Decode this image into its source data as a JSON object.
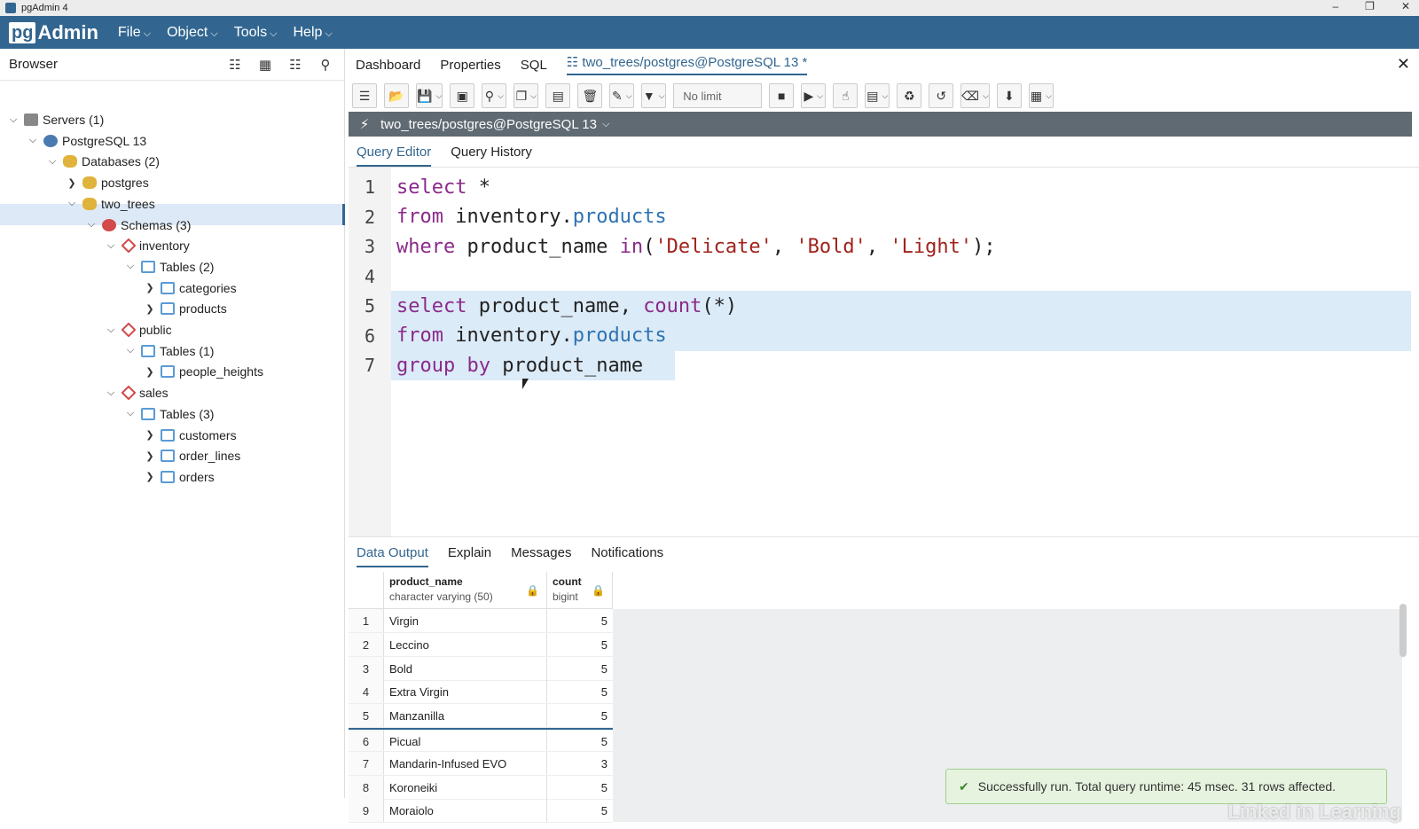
{
  "window": {
    "title": "pgAdmin 4",
    "controls": [
      "–",
      "❐",
      "✕"
    ]
  },
  "menubar": {
    "logo_pg": "pg",
    "logo_admin": "Admin",
    "items": [
      "File",
      "Object",
      "Tools",
      "Help"
    ]
  },
  "browser": {
    "title": "Browser",
    "tree": [
      {
        "label": "Servers (1)",
        "icon": "server-icon",
        "expanded": true
      },
      {
        "label": "PostgreSQL 13",
        "icon": "postgres-icon",
        "expanded": true
      },
      {
        "label": "Databases (2)",
        "icon": "databases-icon",
        "expanded": true
      },
      {
        "label": "postgres",
        "icon": "database-icon",
        "expanded": false
      },
      {
        "label": "two_trees",
        "icon": "database-icon",
        "expanded": true
      },
      {
        "label": "Schemas (3)",
        "icon": "schemas-icon",
        "expanded": true
      },
      {
        "label": "inventory",
        "icon": "schema-icon",
        "expanded": true,
        "selected": true
      },
      {
        "label": "Tables (2)",
        "icon": "tables-icon",
        "expanded": true
      },
      {
        "label": "categories",
        "icon": "table-icon",
        "expanded": false
      },
      {
        "label": "products",
        "icon": "table-icon",
        "expanded": false
      },
      {
        "label": "public",
        "icon": "schema-icon",
        "expanded": true
      },
      {
        "label": "Tables (1)",
        "icon": "tables-icon",
        "expanded": true
      },
      {
        "label": "people_heights",
        "icon": "table-icon",
        "expanded": false
      },
      {
        "label": "sales",
        "icon": "schema-icon",
        "expanded": true
      },
      {
        "label": "Tables (3)",
        "icon": "tables-icon",
        "expanded": true
      },
      {
        "label": "customers",
        "icon": "table-icon",
        "expanded": false
      },
      {
        "label": "order_lines",
        "icon": "table-icon",
        "expanded": false
      },
      {
        "label": "orders",
        "icon": "table-icon",
        "expanded": false
      }
    ]
  },
  "main_tabs": [
    "Dashboard",
    "Properties",
    "SQL",
    "two_trees/postgres@PostgreSQL 13 *"
  ],
  "toolbar": {
    "limit": "No limit"
  },
  "connection": "two_trees/postgres@PostgreSQL 13",
  "query_tabs": [
    "Query Editor",
    "Query History"
  ],
  "editor_lines": [
    "select *",
    "from inventory.products",
    "where product_name in('Delicate', 'Bold', 'Light');",
    "",
    "select product_name, count(*)",
    "from inventory.products",
    "group by product_name"
  ],
  "output_tabs": [
    "Data Output",
    "Explain",
    "Messages",
    "Notifications"
  ],
  "result": {
    "columns": [
      {
        "name": "product_name",
        "type": "character varying (50)"
      },
      {
        "name": "count",
        "type": "bigint"
      }
    ],
    "rows": [
      [
        "Virgin",
        "5"
      ],
      [
        "Leccino",
        "5"
      ],
      [
        "Bold",
        "5"
      ],
      [
        "Extra Virgin",
        "5"
      ],
      [
        "Manzanilla",
        "5"
      ],
      [
        "Picual",
        "5"
      ],
      [
        "Mandarin-Infused EVO",
        "3"
      ],
      [
        "Koroneiki",
        "5"
      ],
      [
        "Moraiolo",
        "5"
      ]
    ]
  },
  "toast": "Successfully run. Total query runtime: 45 msec. 31 rows affected.",
  "watermark": "Linked in Learning"
}
